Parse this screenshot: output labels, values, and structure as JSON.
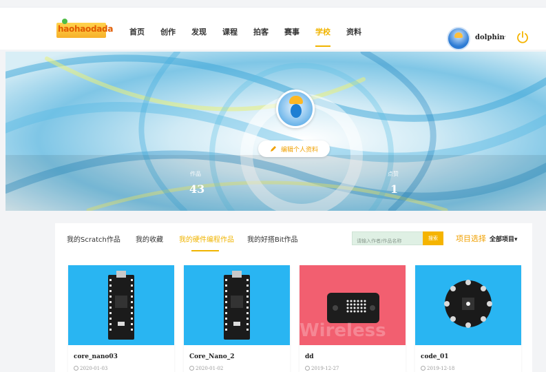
{
  "header": {
    "logo_text": "haohaodada",
    "nav": [
      "首页",
      "创作",
      "发现",
      "课程",
      "拍客",
      "赛事",
      "学校",
      "资料"
    ],
    "active_nav": "学校",
    "user": {
      "name": "dolphin"
    },
    "icons": {
      "power": "power-icon",
      "caret": "chevron-down-icon"
    }
  },
  "profile": {
    "edit_label": "编辑个人资料",
    "stats": [
      {
        "label": "作品",
        "value": "43"
      },
      {
        "label": "点赞",
        "value": "1"
      }
    ]
  },
  "tabs": {
    "items": [
      "我的Scratch作品",
      "我的收藏",
      "我的硬件编程作品",
      "我的好搭Bit作品"
    ],
    "active": "我的硬件编程作品"
  },
  "search": {
    "placeholder": "请输入作者/作品名称",
    "button_label": "搜索"
  },
  "filter": {
    "label": "项目选择",
    "value": "全部项目"
  },
  "cards": [
    {
      "title": "core_nano03",
      "date": "2020-01-03",
      "bg": "#29b5f2",
      "device": "nano"
    },
    {
      "title": "Core_Nano_2",
      "date": "2020-01-02",
      "bg": "#29b5f2",
      "device": "nano"
    },
    {
      "title": "dd",
      "date": "2019-12-27",
      "bg": "#f25f70",
      "device": "matrix",
      "watermark": "Wireless"
    },
    {
      "title": "code_01",
      "date": "2019-12-18",
      "bg": "#29b5f2",
      "device": "round"
    }
  ],
  "colors": {
    "accent": "#f0b400",
    "card_blue": "#29b5f2",
    "card_red": "#f25f70"
  }
}
